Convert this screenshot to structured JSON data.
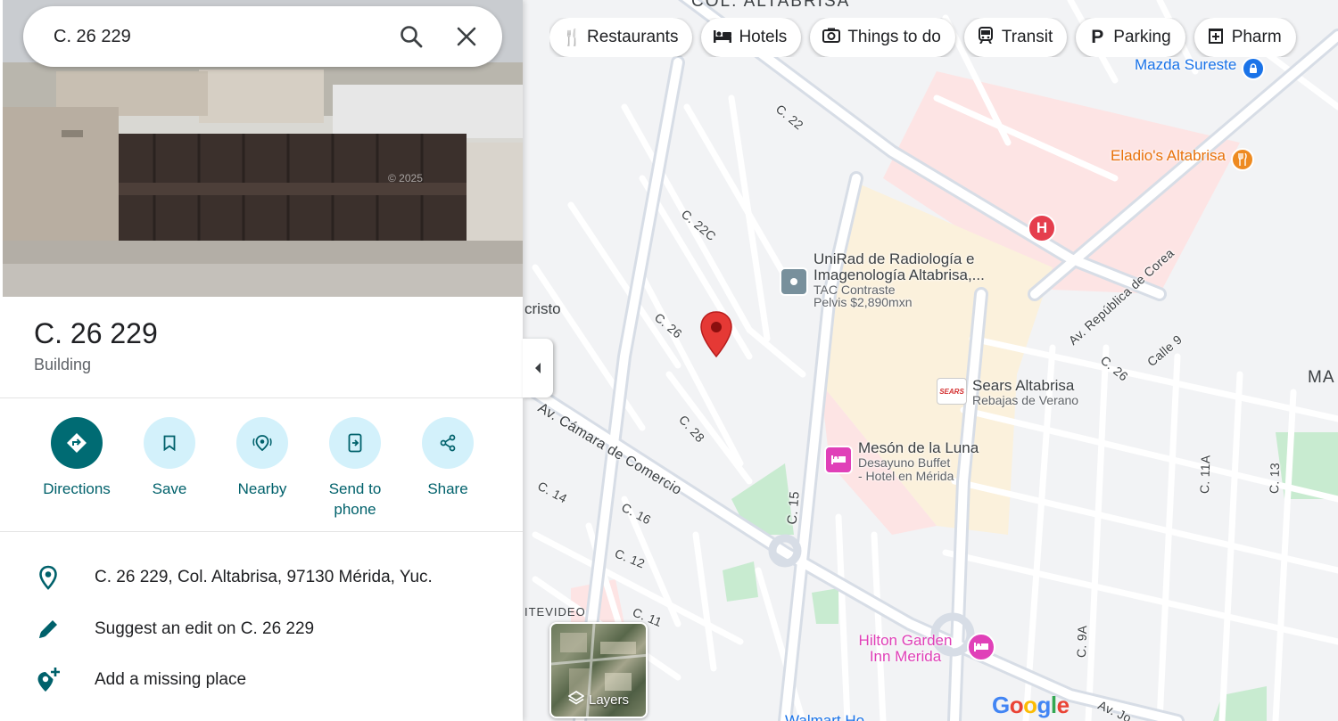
{
  "search": {
    "value": "C. 26 229"
  },
  "place": {
    "title": "C. 26 229",
    "type": "Building",
    "photo_watermark": "© 2025"
  },
  "actions": [
    {
      "label": "Directions"
    },
    {
      "label": "Save"
    },
    {
      "label": "Nearby"
    },
    {
      "label": "Send to phone"
    },
    {
      "label": "Share"
    }
  ],
  "info": {
    "address": "C. 26 229, Col. Altabrisa, 97130 Mérida, Yuc.",
    "suggest_edit": "Suggest an edit on C. 26 229",
    "add_place": "Add a missing place"
  },
  "chips": [
    {
      "label": "Restaurants",
      "icon": "fork-knife-icon"
    },
    {
      "label": "Hotels",
      "icon": "bed-icon"
    },
    {
      "label": "Things to do",
      "icon": "camera-icon"
    },
    {
      "label": "Transit",
      "icon": "train-icon"
    },
    {
      "label": "Parking",
      "icon": "parking-icon"
    },
    {
      "label": "Pharm",
      "icon": "pharmacy-icon"
    }
  ],
  "map": {
    "area_labels": {
      "colonia": "COL. ALTABRISA",
      "cristo": "cristo",
      "montevideo": "ITEVIDEO",
      "ma": "MA"
    },
    "streets": {
      "c22": "C. 22",
      "c22c": "C. 22C",
      "c26": "C. 26",
      "c28": "C. 28",
      "c26b": "C. 26",
      "calle9": "Calle 9",
      "corea": "Av. República de Corea",
      "camara": "Av. Cámara de Comercio",
      "c14": "C. 14",
      "c16": "C. 16",
      "c12": "C. 12",
      "c11": "C. 11",
      "c15": "C. 15",
      "c11a": "C. 11A",
      "c13": "C. 13",
      "c9a": "C. 9A",
      "av_jo": "Av. Jo"
    },
    "pois": {
      "mazda": "Mazda Sureste",
      "eladio": "Eladio's Altabrisa",
      "hospital": "H",
      "unirad_name": "UniRad de Radiología e Imagenología Altabrisa,...",
      "unirad_sub1": "TAC Contraste",
      "unirad_sub2": "Pelvis $2,890mxn",
      "sears_name": "Sears Altabrisa",
      "sears_sub": "Rebajas de Verano",
      "sears_logo": "SEARS",
      "meson_name": "Mesón de la Luna",
      "meson_sub1": "Desayuno Buffet",
      "meson_sub2": "- Hotel en Mérida",
      "hilton_name": "Hilton Garden Inn Merida",
      "walmart": "Walmart Ho"
    },
    "layers_label": "Layers",
    "google_logo": "Google",
    "colors": {
      "hospital_area": "#fde4e4",
      "mall_area": "#fbf1dc",
      "park": "#c8ebd0",
      "road_major": "#d7dde6",
      "restaurant": "#ee8a20",
      "hotel": "#e040b8",
      "hospital": "#e53e4d",
      "pin": "#e53935",
      "poi_blue": "#1a73e8",
      "teal": "#006b73"
    }
  }
}
